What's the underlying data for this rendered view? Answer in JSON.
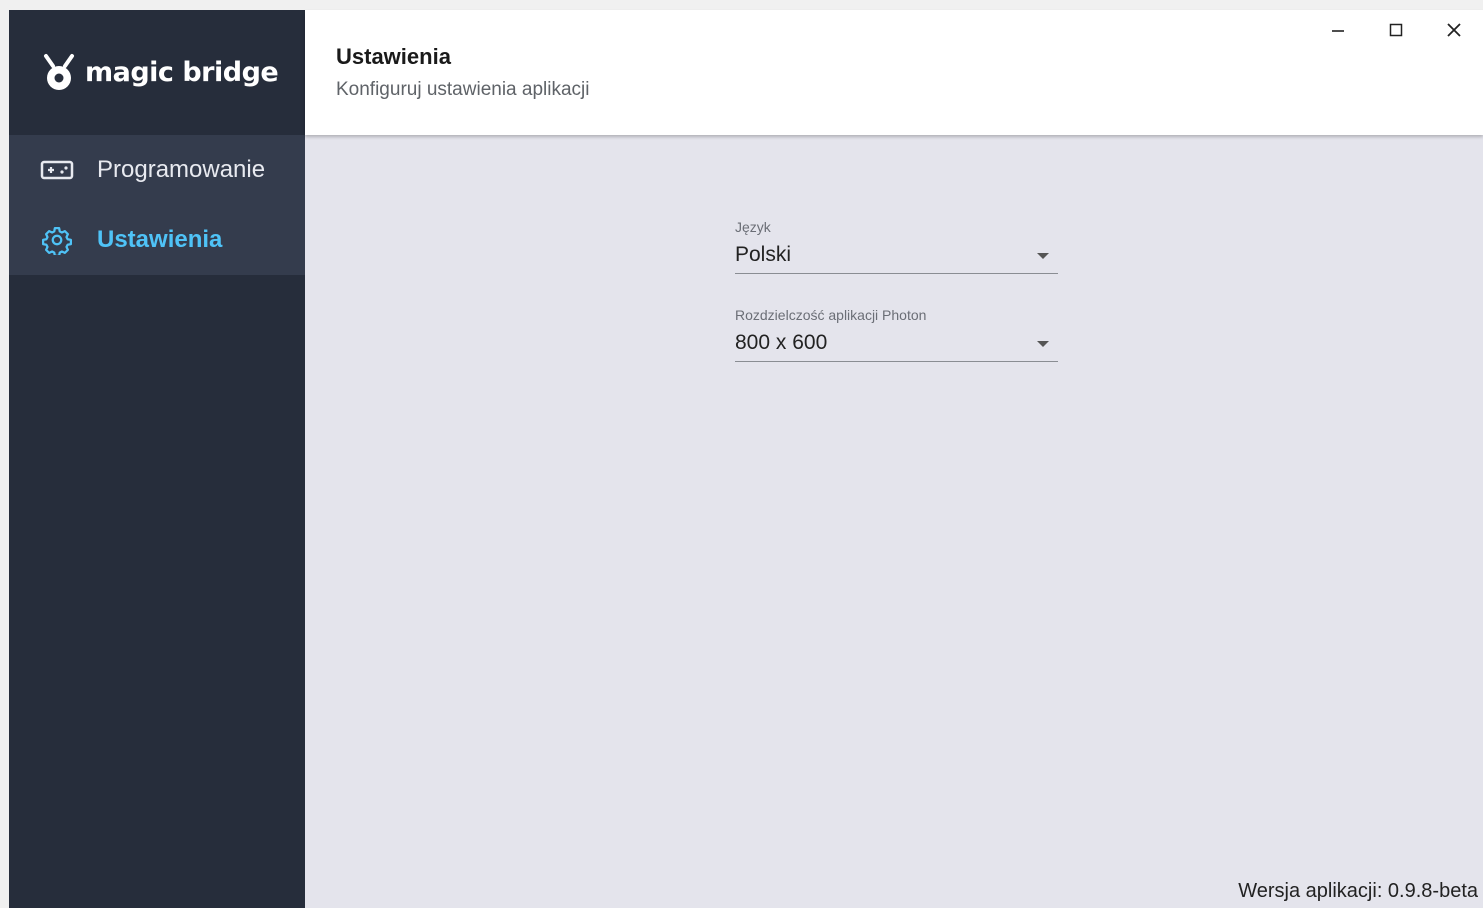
{
  "app": {
    "logo_text": "magic bridge"
  },
  "sidebar": {
    "items": [
      {
        "label": "Programowanie",
        "icon": "gamepad-icon",
        "active": false
      },
      {
        "label": "Ustawienia",
        "icon": "gear-icon",
        "active": true
      }
    ]
  },
  "header": {
    "title": "Ustawienia",
    "subtitle": "Konfiguruj ustawienia aplikacji"
  },
  "window_controls": {
    "minimize": "minimize-icon",
    "maximize": "maximize-icon",
    "close": "close-icon"
  },
  "settings": {
    "language": {
      "label": "Język",
      "value": "Polski"
    },
    "resolution": {
      "label": "Rozdzielczość aplikacji Photon",
      "value": "800 x 600"
    }
  },
  "footer": {
    "version": "Wersja aplikacji: 0.9.8-beta"
  },
  "colors": {
    "sidebar_bg": "#262d3b",
    "nav_bg": "#343c4d",
    "accent": "#4fc3f7",
    "content_bg": "#e4e4ec"
  }
}
